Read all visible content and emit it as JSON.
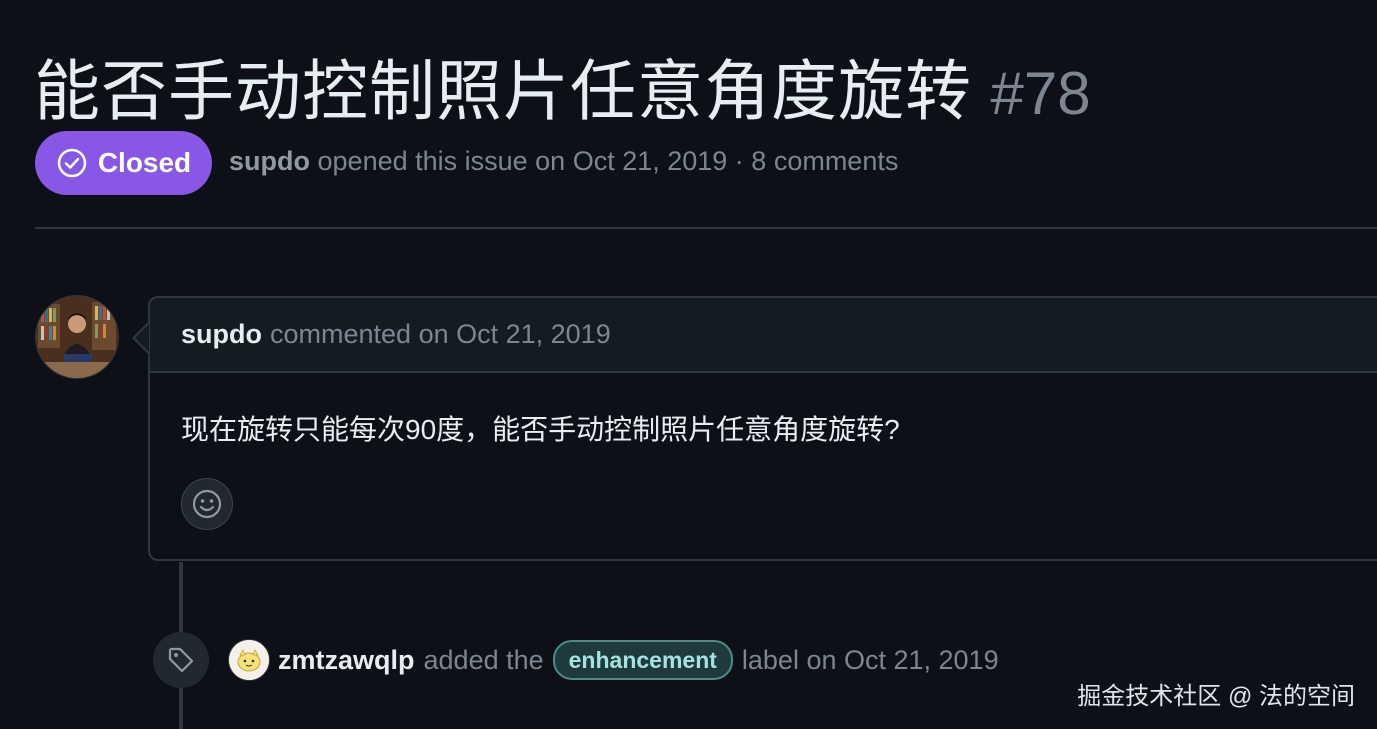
{
  "issue": {
    "title": "能否手动控制照片任意角度旋转",
    "number": "#78",
    "state": "Closed",
    "author": "supdo",
    "meta_text": "opened this issue on Oct 21, 2019 · 8 comments"
  },
  "comment": {
    "author": "supdo",
    "meta": "commented on Oct 21, 2019",
    "body": "现在旋转只能每次90度，能否手动控制照片任意角度旋转?"
  },
  "event": {
    "actor": "zmtzawqlp",
    "text_before": "added the",
    "label": "enhancement",
    "text_after": "label on Oct 21, 2019"
  },
  "watermark": "掘金技术社区 @ 法的空间",
  "colors": {
    "background": "#0d1117",
    "closed_badge": "#8957e5",
    "label_border": "#4d8a88",
    "label_text": "#a6e3e0"
  },
  "icons": {
    "state": "check-circle-icon",
    "reaction": "smiley-icon",
    "event": "tag-icon"
  }
}
